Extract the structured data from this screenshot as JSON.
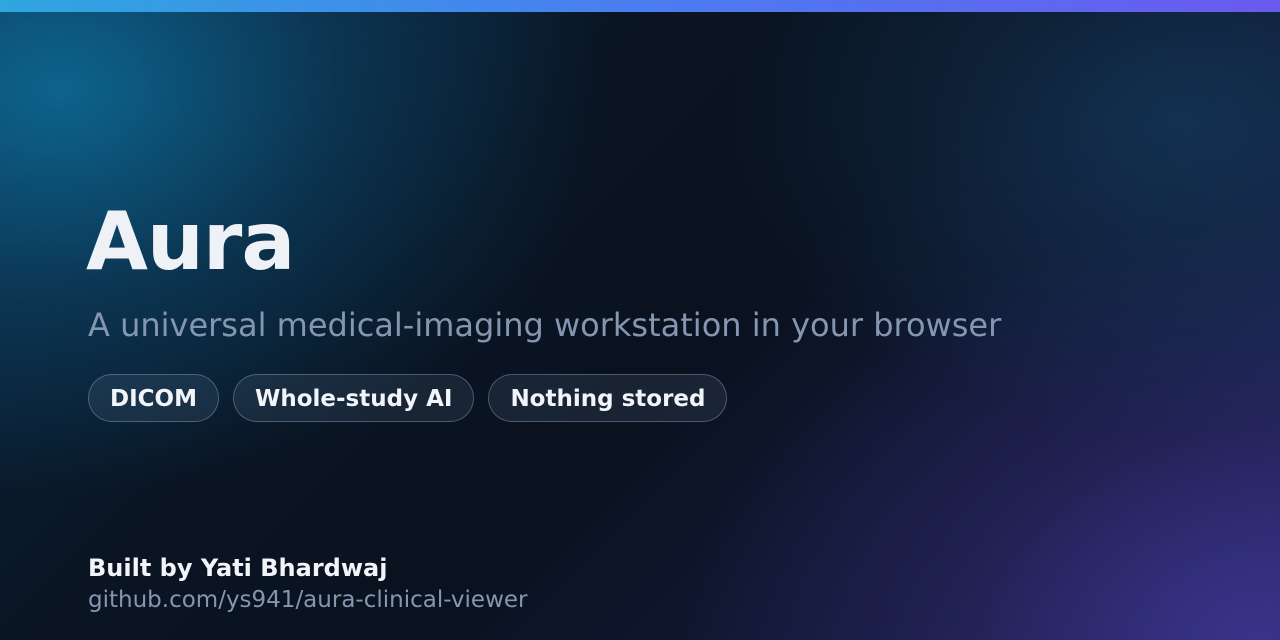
{
  "card": {
    "title": "Aura",
    "subtitle": "A universal medical-imaging workstation in your browser",
    "tags": [
      "DICOM",
      "Whole-study AI",
      "Nothing stored"
    ],
    "byline": "Built by Yati Bhardwaj",
    "repo_link": "github.com/ys941/aura-clinical-viewer"
  },
  "colors": {
    "accent_bar_start": "#2fa6e0",
    "accent_bar_end": "#6a5af0",
    "title": "#eef2f7",
    "muted_text": "#8596b0",
    "background": "#0a1220"
  }
}
